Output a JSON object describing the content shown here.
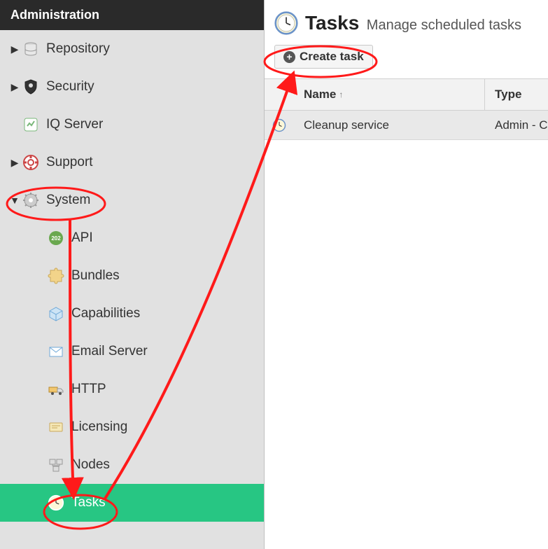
{
  "sidebar": {
    "title": "Administration",
    "items": [
      {
        "label": "Repository",
        "icon": "database-icon",
        "expandable": true,
        "expanded": false,
        "level": 0
      },
      {
        "label": "Security",
        "icon": "shield-icon",
        "expandable": true,
        "expanded": false,
        "level": 0
      },
      {
        "label": "IQ Server",
        "icon": "iq-icon",
        "expandable": false,
        "level": 0
      },
      {
        "label": "Support",
        "icon": "lifebuoy-icon",
        "expandable": true,
        "expanded": false,
        "level": 0
      },
      {
        "label": "System",
        "icon": "gear-icon",
        "expandable": true,
        "expanded": true,
        "level": 0
      },
      {
        "label": "API",
        "icon": "api-icon",
        "level": 1
      },
      {
        "label": "Bundles",
        "icon": "puzzle-icon",
        "level": 1
      },
      {
        "label": "Capabilities",
        "icon": "box-icon",
        "level": 1
      },
      {
        "label": "Email Server",
        "icon": "mail-icon",
        "level": 1
      },
      {
        "label": "HTTP",
        "icon": "truck-icon",
        "level": 1
      },
      {
        "label": "Licensing",
        "icon": "license-icon",
        "level": 1
      },
      {
        "label": "Nodes",
        "icon": "nodes-icon",
        "level": 1
      },
      {
        "label": "Tasks",
        "icon": "clock-icon",
        "level": 1,
        "active": true
      }
    ]
  },
  "page": {
    "title": "Tasks",
    "subtitle": "Manage scheduled tasks"
  },
  "toolbar": {
    "create_label": "Create task"
  },
  "table": {
    "columns": {
      "name": "Name",
      "type": "Type"
    },
    "rows": [
      {
        "name": "Cleanup service",
        "type": "Admin - C"
      }
    ]
  }
}
